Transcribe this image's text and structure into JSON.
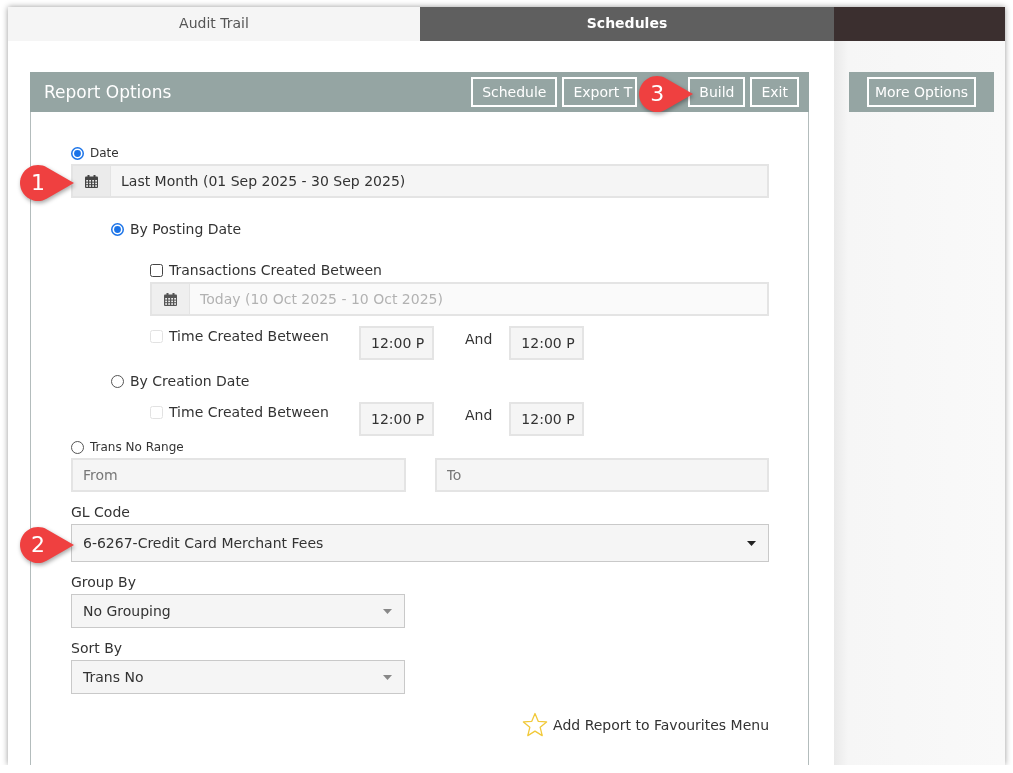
{
  "tabs": [
    {
      "label": "Audit Trail",
      "selected": true
    },
    {
      "label": "Schedules",
      "selected": false
    }
  ],
  "report_options": {
    "title": "Report Options",
    "buttons": [
      {
        "label": "Schedule"
      },
      {
        "label": "Export T"
      },
      {
        "label": "Build",
        "callout": "3"
      },
      {
        "label": "Exit"
      }
    ],
    "criteria": [
      {
        "kind": "date",
        "label": "Date",
        "selected": true,
        "range": {
          "value": "Last Month (01 Sep 2025 - 30 Sep 2025)",
          "disabled": false,
          "callout": "1"
        },
        "date_types": [
          {
            "label": "By Posting Date",
            "selected": true,
            "options": [
              {
                "kind": "date_range",
                "label": "Transactions Created Between",
                "checked": false,
                "disabled": false,
                "range": {
                  "value": "Today (10 Oct 2025 - 10 Oct 2025)",
                  "disabled": true
                }
              },
              {
                "kind": "time_range",
                "label": "Time Created Between",
                "checked": false,
                "disabled": true,
                "from": "12:00 P",
                "joiner": "And",
                "to": "12:00 P"
              }
            ]
          },
          {
            "label": "By Creation Date",
            "selected": false,
            "options": [
              {
                "kind": "time_range",
                "label": "Time Created Between",
                "checked": false,
                "disabled": true,
                "from": "12:00 P",
                "joiner": "And",
                "to": "12:00 P"
              }
            ]
          }
        ]
      },
      {
        "kind": "range",
        "label": "Trans No Range",
        "selected": false,
        "fields": [
          {
            "placeholder": "From"
          },
          {
            "placeholder": "To"
          }
        ]
      }
    ],
    "dropdowns": [
      {
        "kind": "wide",
        "label": "GL Code",
        "value": "6-6267-Credit Card Merchant Fees",
        "callout": "2"
      },
      {
        "kind": "narrow",
        "label": "Group By",
        "value": "No Grouping"
      },
      {
        "kind": "narrow",
        "label": "Sort By",
        "value": "Trans No"
      }
    ],
    "favourites": {
      "label": "Add Report to Favourites Menu"
    }
  },
  "side_panel": {
    "button": "More Options"
  }
}
